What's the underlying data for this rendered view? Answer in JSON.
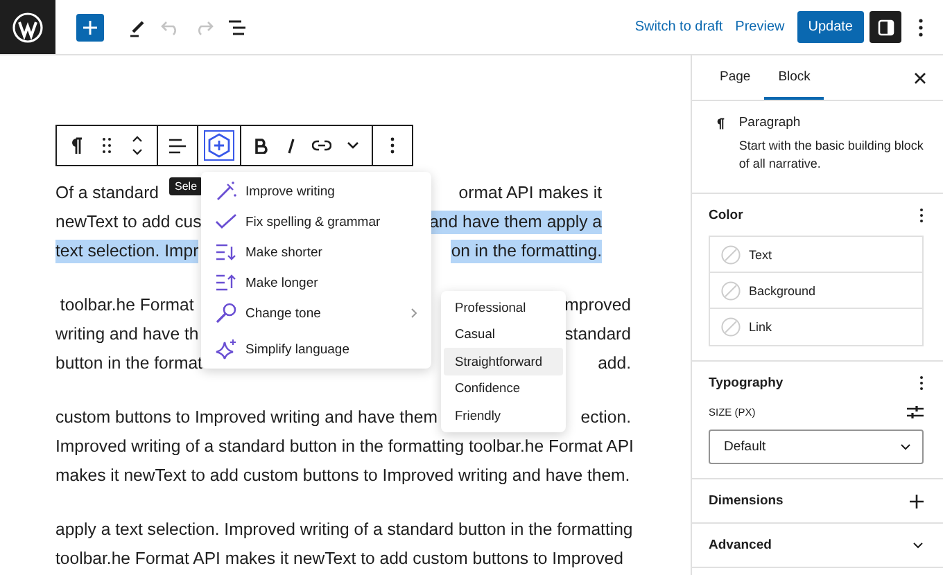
{
  "top_bar": {
    "undo_disabled": true,
    "redo_disabled": true,
    "links": [
      "Switch to draft",
      "Preview"
    ],
    "primary": "Update",
    "sidebar_toggle_on": true
  },
  "block_toolbar": {
    "ai_active": true
  },
  "tooltip": "Sele",
  "editor": {
    "paragraphs": [
      [
        [
          {
            "text": "Of a standard",
            "highlighted": false
          },
          {
            "text": "ormat API makes it",
            "highlighted": false
          }
        ],
        [
          {
            "text": "newText to add cus",
            "highlighted": false
          },
          {
            "text": "and have them apply a",
            "highlighted": true
          }
        ],
        [
          {
            "text": "text selection. Impr",
            "highlighted": true
          },
          {
            "text": "on in the formatting.",
            "highlighted": true
          }
        ]
      ],
      [
        [
          {
            "text": " toolbar.he Format",
            "highlighted": false
          },
          {
            "text": "mproved",
            "highlighted": false
          }
        ],
        [
          {
            "text": "writing and have th",
            "highlighted": false
          },
          {
            "text": "standard",
            "highlighted": false
          }
        ],
        [
          {
            "text": "button in the format",
            "highlighted": false
          },
          {
            "text": "add.",
            "highlighted": false
          }
        ]
      ],
      [
        [
          {
            "text": "custom buttons to Improved writing and have them",
            "highlighted": false
          },
          {
            "text": "ection.",
            "highlighted": false
          }
        ],
        [
          {
            "text": "Improved writing of a standard button in the formatting toolbar.he Format API",
            "highlighted": false
          }
        ],
        [
          {
            "text": "makes it newText to add custom buttons to Improved writing and have them.",
            "highlighted": false
          }
        ]
      ],
      [
        [
          {
            "text": "apply a text selection. Improved writing of a standard button in the formatting",
            "highlighted": false
          }
        ],
        [
          {
            "text": "toolbar.he Format API makes it newText to add custom buttons to Improved",
            "highlighted": false
          }
        ]
      ]
    ]
  },
  "ai_menu": {
    "items": [
      {
        "label": "Improve writing",
        "kind": "wand",
        "has_submenu": false
      },
      {
        "label": "Fix spelling & grammar",
        "kind": "check",
        "has_submenu": false
      },
      {
        "label": "Make shorter",
        "kind": "shorter",
        "has_submenu": false
      },
      {
        "label": "Make longer",
        "kind": "longer",
        "has_submenu": false
      },
      {
        "label": "Change tone",
        "kind": "mic",
        "has_submenu": true
      },
      {
        "label": "Simplify language",
        "kind": "sparkle",
        "has_submenu": false
      }
    ]
  },
  "tone_menu": {
    "items": [
      {
        "label": "Professional",
        "selected": false
      },
      {
        "label": "Casual",
        "selected": false
      },
      {
        "label": "Straightforward",
        "selected": true
      },
      {
        "label": "Confidence",
        "selected": false
      },
      {
        "label": "Friendly",
        "selected": false
      }
    ]
  },
  "sidebar": {
    "tabs": [
      {
        "label": "Page",
        "selected": false
      },
      {
        "label": "Block",
        "selected": true
      }
    ],
    "block": {
      "name": "Paragraph",
      "description": "Start with the basic building block of all narrative."
    },
    "color": {
      "title": "Color",
      "items": [
        "Text",
        "Background",
        "Link"
      ]
    },
    "typography": {
      "title": "Typography",
      "size_label": "SIZE (PX)",
      "value": "Default"
    },
    "panels": [
      {
        "title": "Dimensions",
        "kind": "add"
      },
      {
        "title": "Advanced",
        "kind": "expand"
      }
    ]
  }
}
